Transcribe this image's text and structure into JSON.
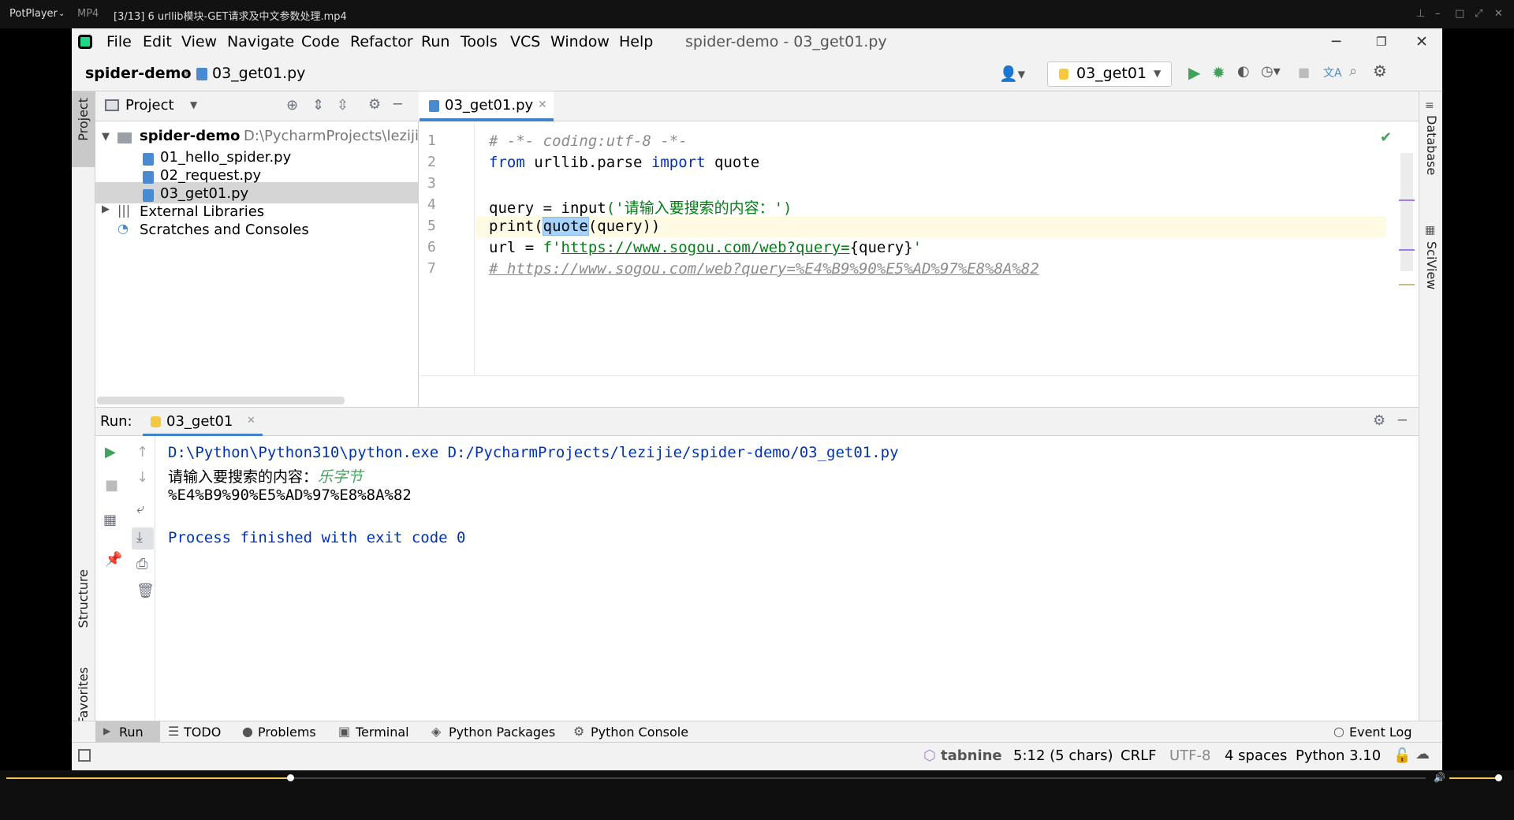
{
  "player": {
    "name": "PotPlayer",
    "chevron": "⌄",
    "format": "MP4",
    "file": "[3/13] 6 urllib模块-GET请求及中文参数处理.mp4"
  },
  "menu": {
    "items": [
      "File",
      "Edit",
      "View",
      "Navigate",
      "Code",
      "Refactor",
      "Run",
      "Tools",
      "VCS",
      "Window",
      "Help"
    ],
    "window_title": "spider-demo - 03_get01.py"
  },
  "nav": {
    "project": "spider-demo",
    "sep": "›",
    "file": "03_get01.py",
    "run_config": "03_get01"
  },
  "project_panel": {
    "title": "Project",
    "root_name": "spider-demo",
    "root_path": "D:\\PycharmProjects\\lezijie",
    "files": [
      "01_hello_spider.py",
      "02_request.py",
      "03_get01.py"
    ],
    "external": "External Libraries",
    "scratches": "Scratches and Consoles"
  },
  "editor": {
    "tab": "03_get01.py",
    "line_numbers": [
      "1",
      "2",
      "3",
      "4",
      "5",
      "6",
      "7"
    ],
    "line1": "# -*- coding:utf-8 -*-",
    "line2_kw1": "from",
    "line2_mod": " urllib.parse ",
    "line2_kw2": "import",
    "line2_name": " quote",
    "line4_a": "query = ",
    "line4_fn": "input",
    "line4_str": "('请输入要搜索的内容：')",
    "line5_a": "print(",
    "line5_sel": "quote",
    "line5_b": "(query))",
    "line6_a": "url = ",
    "line6_f": "f'",
    "line6_url": "https://www.sogou.com/web?query=",
    "line6_b": "{query}",
    "line6_c": "'",
    "line7": "# https://www.sogou.com/web?query=%E4%B9%90%E5%AD%97%E8%8A%82"
  },
  "run_panel": {
    "label": "Run:",
    "tab": "03_get01",
    "cmd": "D:\\Python\\Python310\\python.exe D:/PycharmProjects/lezijie/spider-demo/03_get01.py",
    "prompt": "请输入要搜索的内容：",
    "input": "乐字节",
    "result": "%E4%B9%90%E5%AD%97%E8%8A%82",
    "finished": "Process finished with exit code 0"
  },
  "side_tabs": {
    "project": "Project",
    "structure": "Structure",
    "favorites": "Favorites",
    "database": "Database",
    "sciview": "SciView"
  },
  "bottom_tabs": [
    "Run",
    "TODO",
    "Problems",
    "Terminal",
    "Python Packages",
    "Python Console"
  ],
  "event_log": "Event Log",
  "status": {
    "tabnine": "tabnine",
    "position": "5:12 (5 chars)",
    "line_sep": "CRLF",
    "encoding": "UTF-8",
    "indent": "4 spaces",
    "interpreter": "Python 3.10"
  },
  "playback": {
    "progress": 0.2
  }
}
